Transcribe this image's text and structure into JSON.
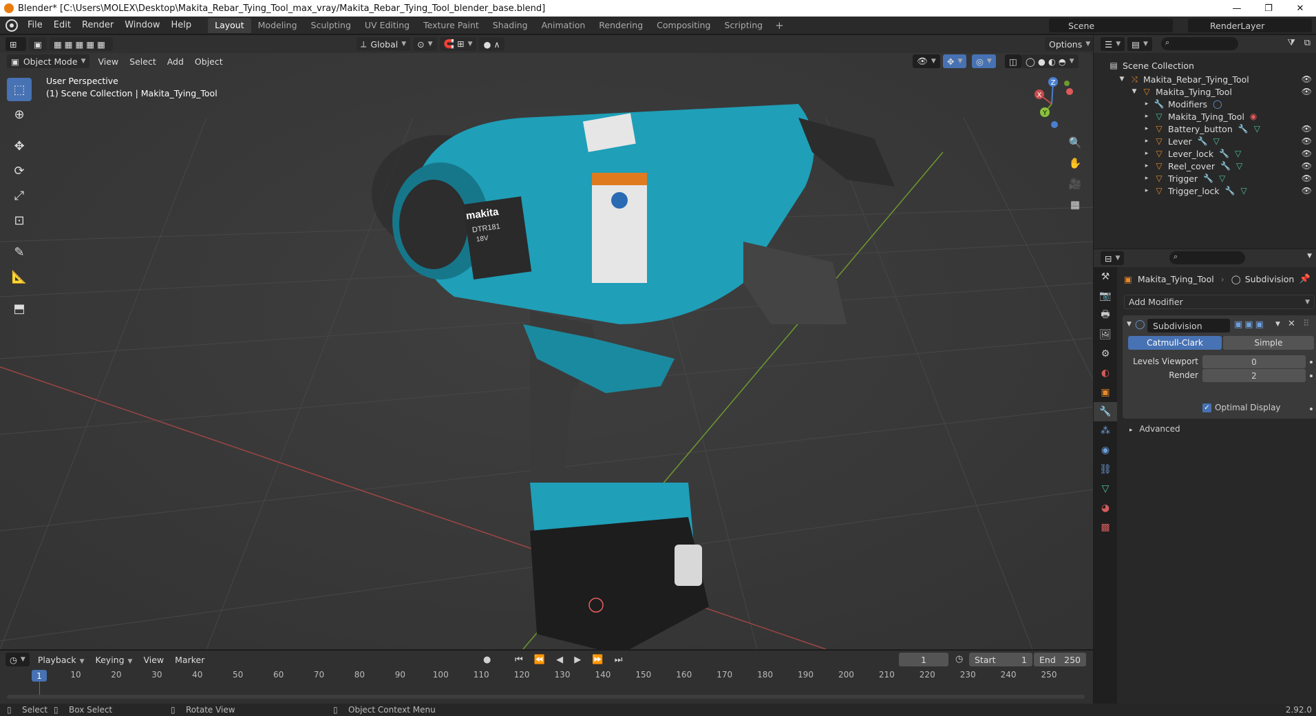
{
  "window": {
    "title": "Blender* [C:\\Users\\MOLEX\\Desktop\\Makita_Rebar_Tying_Tool_max_vray/Makita_Rebar_Tying_Tool_blender_base.blend]",
    "minimize": "—",
    "maximize": "❐",
    "close": "✕"
  },
  "menu": [
    "File",
    "Edit",
    "Render",
    "Window",
    "Help"
  ],
  "workspaces": [
    "Layout",
    "Modeling",
    "Sculpting",
    "UV Editing",
    "Texture Paint",
    "Shading",
    "Animation",
    "Rendering",
    "Compositing",
    "Scripting"
  ],
  "active_workspace": "Layout",
  "scene": "Scene",
  "render_layer": "RenderLayer",
  "viewport": {
    "mode": "Object Mode",
    "menus": [
      "View",
      "Select",
      "Add",
      "Object"
    ],
    "orientation": "Global",
    "options": "Options",
    "info_line1": "User Perspective",
    "info_line2": "(1) Scene Collection | Makita_Tying_Tool",
    "gizmo_x": "X",
    "gizmo_y": "Y",
    "gizmo_z": "Z",
    "model_label_brand": "makita",
    "model_label_code": "DTR181",
    "model_label_volt": "18V"
  },
  "timeline": {
    "menus": [
      "Playback",
      "Keying",
      "View",
      "Marker"
    ],
    "current_frame": "1",
    "start_label": "Start",
    "start": "1",
    "end_label": "End",
    "end": "250",
    "cursor_badge": "1",
    "ticks": [
      "10",
      "20",
      "30",
      "40",
      "50",
      "60",
      "70",
      "80",
      "90",
      "100",
      "110",
      "120",
      "130",
      "140",
      "150",
      "160",
      "170",
      "180",
      "190",
      "200",
      "210",
      "220",
      "230",
      "240",
      "250"
    ]
  },
  "status": {
    "select": "Select",
    "box_select": "Box Select",
    "rotate": "Rotate View",
    "context": "Object Context Menu",
    "version": "2.92.0"
  },
  "outliner": {
    "root": "Scene Collection",
    "items": [
      {
        "label": "Makita_Rebar_Tying_Tool"
      },
      {
        "label": "Makita_Tying_Tool"
      },
      {
        "label": "Modifiers"
      },
      {
        "label": "Makita_Tying_Tool"
      },
      {
        "label": "Battery_button"
      },
      {
        "label": "Lever"
      },
      {
        "label": "Lever_lock"
      },
      {
        "label": "Reel_cover"
      },
      {
        "label": "Trigger"
      },
      {
        "label": "Trigger_lock"
      }
    ]
  },
  "properties": {
    "object": "Makita_Tying_Tool",
    "modifier_crumb": "Subdivision",
    "add_modifier": "Add Modifier",
    "modifier_name": "Subdivision",
    "catmull": "Catmull-Clark",
    "simple": "Simple",
    "levels_label": "Levels Viewport",
    "levels_value": "0",
    "render_label": "Render",
    "render_value": "2",
    "optimal_display": "Optimal Display",
    "advanced": "Advanced"
  },
  "colors": {
    "accent": "#4772b3",
    "x_axis": "#c84b4b",
    "y_axis": "#6e9a2d",
    "tool_body": "#1f9fb8"
  }
}
